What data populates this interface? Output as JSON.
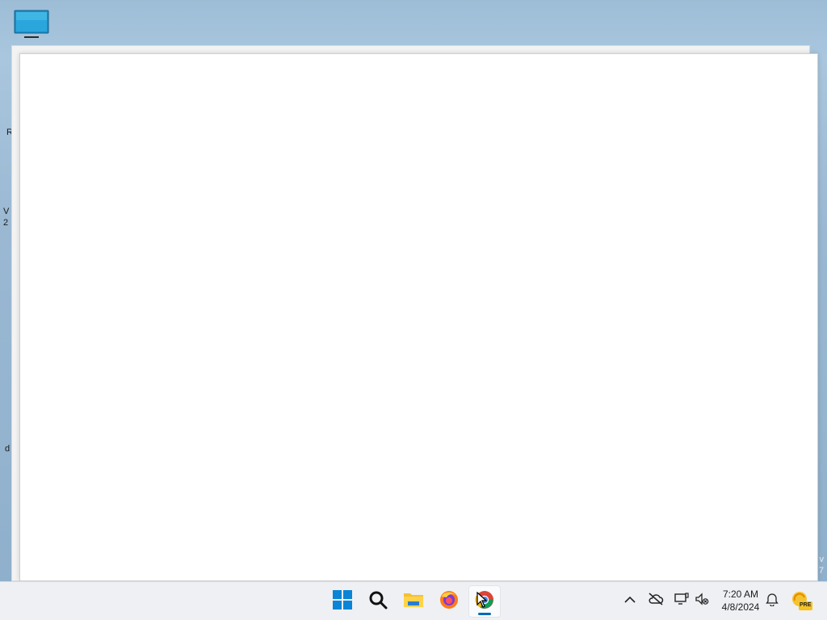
{
  "desktop": {
    "icon_name": "this-pc-icon",
    "peek_text": [
      "R",
      "V",
      "2",
      "d"
    ],
    "watermark": [
      "v",
      "7"
    ]
  },
  "window": {
    "content": ""
  },
  "taskbar": {
    "apps": [
      {
        "name": "start-button",
        "icon": "windows-logo-icon"
      },
      {
        "name": "search-button",
        "icon": "search-icon"
      },
      {
        "name": "file-explorer-button",
        "icon": "folder-icon"
      },
      {
        "name": "firefox-button",
        "icon": "firefox-icon"
      },
      {
        "name": "chrome-button",
        "icon": "chrome-icon",
        "active": true
      }
    ],
    "tray": {
      "icons": [
        "chevron-up-icon",
        "cloud-off-icon",
        "network-icon",
        "speaker-muted-icon",
        "bell-icon",
        "copilot-pre-icon"
      ],
      "badge": "PRE"
    },
    "clock": {
      "time": "7:20 AM",
      "date": "4/8/2024"
    }
  },
  "colors": {
    "accent": "#0067c0",
    "taskbar_bg": "#eef0f3",
    "desktop_bg": "#9ab8d2"
  }
}
